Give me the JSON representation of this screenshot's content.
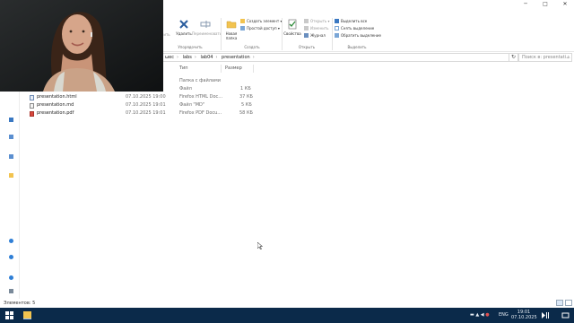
{
  "window": {
    "minimize": "─",
    "maximize": "□",
    "close": "✕"
  },
  "ribbon": {
    "organize": {
      "fragment_left": "ить",
      "delete": "Удалить",
      "rename": "Переименовать",
      "label": "Упорядочить"
    },
    "create": {
      "new_folder": "Новая папка",
      "new_item": "Создать элемент ▾",
      "easy_access": "Простой доступ ▾",
      "label": "Создать"
    },
    "open": {
      "properties": "Свойства",
      "open": "Открыть ▾",
      "edit": "Изменить",
      "history": "Журнал",
      "label": "Открыть"
    },
    "select": {
      "select_all": "Выделить все",
      "select_none": "Снять выделение",
      "invert": "Обратить выделение",
      "label": "Выделить"
    }
  },
  "address": {
    "crumbs": [
      "ωес",
      "labs",
      "lab04",
      "presentation"
    ],
    "refresh": "↻",
    "search_placeholder": "Поиск в: presentati..."
  },
  "columns": {
    "type": "Тип",
    "size": "Размер"
  },
  "files": [
    {
      "name": "",
      "date": "",
      "type": "Папка с файлами",
      "size": "",
      "icon": "folder-icon"
    },
    {
      "name": "",
      "date": "",
      "type": "Файл",
      "size": "1 КБ",
      "icon": "file-icon"
    },
    {
      "name": "presentation.html",
      "date": "07.10.2025 19:00",
      "type": "Firefox HTML Doc...",
      "size": "37 КБ",
      "icon": "html-file-icon"
    },
    {
      "name": "presentation.md",
      "date": "07.10.2025 19:01",
      "type": "Файл \"MD\"",
      "size": "5 КБ",
      "icon": "md-file-icon"
    },
    {
      "name": "presentation.pdf",
      "date": "07.10.2025 19:01",
      "type": "Firefox PDF Docu...",
      "size": "58 КБ",
      "icon": "pdf-file-icon"
    }
  ],
  "status": {
    "items": "Элементов: 5"
  },
  "taskbar": {
    "lang": "ENG",
    "time": "19:01",
    "date": "07.10.2025"
  },
  "colors": {
    "taskbar": "#0b2a4a",
    "accent": "#1e6fc8"
  }
}
